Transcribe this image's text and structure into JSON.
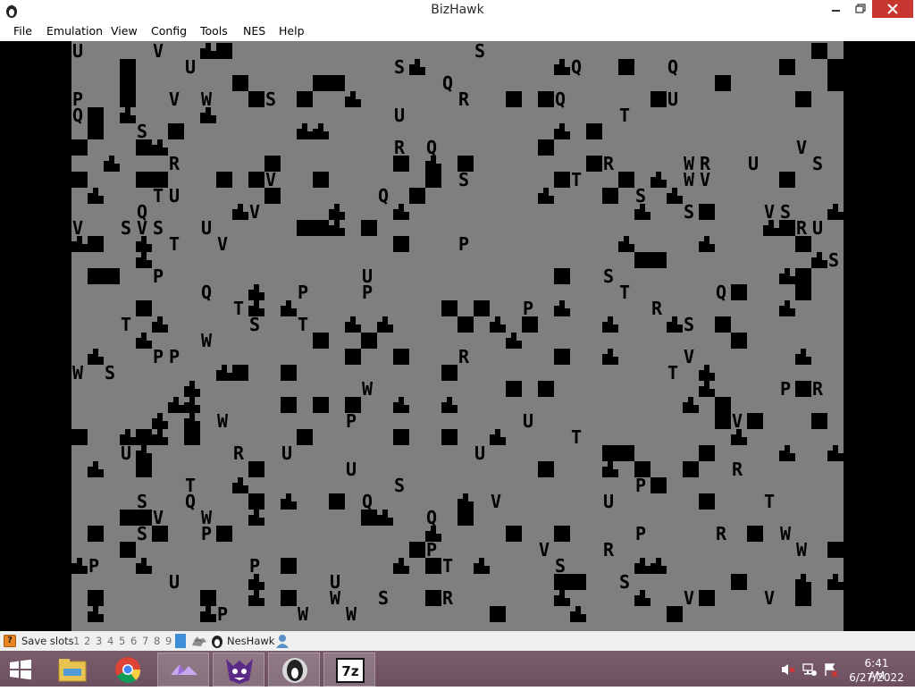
{
  "window": {
    "title": "BizHawk"
  },
  "menu": {
    "items": [
      "File",
      "Emulation",
      "View",
      "Config",
      "Tools",
      "NES",
      "Help"
    ]
  },
  "game": {
    "description_colors": {
      "background": "#7f7f7f",
      "tiles": "#000000"
    }
  },
  "status": {
    "save_slots_label": "Save slots",
    "slots": [
      "1",
      "2",
      "3",
      "4",
      "5",
      "6",
      "7",
      "8",
      "9",
      "0"
    ],
    "core": "NesHawk"
  },
  "taskbar": {
    "apps": [
      "file-explorer-icon",
      "chrome-icon",
      "app-purple-icon",
      "app-mascot-icon",
      "bizhawk-icon",
      "7zip-icon"
    ],
    "seven_zip_label": "7z"
  },
  "tray": {
    "time": "6:41 AM",
    "date": "6/27/2022"
  },
  "colors": {
    "taskbar": "#735766",
    "close_button": "#c7372f",
    "slot_highlight": "#3f8fd8"
  }
}
